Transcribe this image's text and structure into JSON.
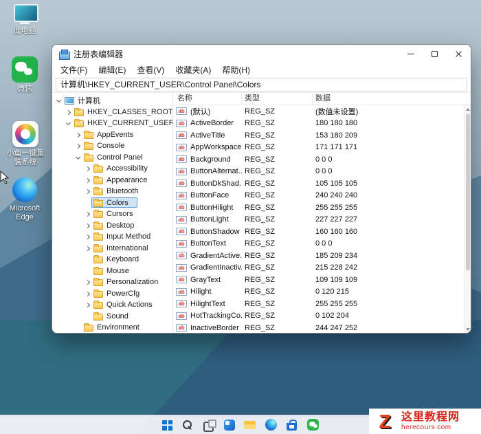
{
  "desktop": {
    "icons": [
      {
        "id": "this-pc",
        "label": "此电脑"
      },
      {
        "id": "wechat",
        "label": "微信"
      },
      {
        "id": "xiaoyu-reinstall",
        "label": "小鱼一键重装系统"
      },
      {
        "id": "microsoft-edge",
        "label": "Microsoft Edge"
      }
    ]
  },
  "window": {
    "title": "注册表编辑器",
    "menus": [
      {
        "id": "file",
        "label": "文件(F)"
      },
      {
        "id": "edit",
        "label": "编辑(E)"
      },
      {
        "id": "view",
        "label": "查看(V)"
      },
      {
        "id": "favorites",
        "label": "收藏夹(A)"
      },
      {
        "id": "help",
        "label": "帮助(H)"
      }
    ],
    "address": "计算机\\HKEY_CURRENT_USER\\Control Panel\\Colors",
    "tree": [
      {
        "id": "computer",
        "label": "计算机",
        "depth": 0,
        "icon": "computer",
        "chevron": "open",
        "selected": false
      },
      {
        "id": "hkey-classes-root",
        "label": "HKEY_CLASSES_ROOT",
        "depth": 1,
        "icon": "folder",
        "chevron": "closed",
        "selected": false
      },
      {
        "id": "hkey-current-user",
        "label": "HKEY_CURRENT_USER",
        "depth": 1,
        "icon": "folder",
        "chevron": "open",
        "selected": false
      },
      {
        "id": "appevents",
        "label": "AppEvents",
        "depth": 2,
        "icon": "folder",
        "chevron": "closed",
        "selected": false
      },
      {
        "id": "console",
        "label": "Console",
        "depth": 2,
        "icon": "folder",
        "chevron": "closed",
        "selected": false
      },
      {
        "id": "control-panel",
        "label": "Control Panel",
        "depth": 2,
        "icon": "folder",
        "chevron": "open",
        "selected": false
      },
      {
        "id": "accessibility",
        "label": "Accessibility",
        "depth": 3,
        "icon": "folder",
        "chevron": "closed",
        "selected": false
      },
      {
        "id": "appearance",
        "label": "Appearance",
        "depth": 3,
        "icon": "folder",
        "chevron": "closed",
        "selected": false
      },
      {
        "id": "bluetooth",
        "label": "Bluetooth",
        "depth": 3,
        "icon": "folder",
        "chevron": "closed",
        "selected": false
      },
      {
        "id": "colors",
        "label": "Colors",
        "depth": 3,
        "icon": "folder",
        "chevron": "none",
        "selected": true
      },
      {
        "id": "cursors",
        "label": "Cursors",
        "depth": 3,
        "icon": "folder",
        "chevron": "closed",
        "selected": false
      },
      {
        "id": "desktop",
        "label": "Desktop",
        "depth": 3,
        "icon": "folder",
        "chevron": "closed",
        "selected": false
      },
      {
        "id": "input-method",
        "label": "Input Method",
        "depth": 3,
        "icon": "folder",
        "chevron": "closed",
        "selected": false
      },
      {
        "id": "international",
        "label": "International",
        "depth": 3,
        "icon": "folder",
        "chevron": "closed",
        "selected": false
      },
      {
        "id": "keyboard",
        "label": "Keyboard",
        "depth": 3,
        "icon": "folder",
        "chevron": "none",
        "selected": false
      },
      {
        "id": "mouse",
        "label": "Mouse",
        "depth": 3,
        "icon": "folder",
        "chevron": "none",
        "selected": false
      },
      {
        "id": "personalization",
        "label": "Personalization",
        "depth": 3,
        "icon": "folder",
        "chevron": "closed",
        "selected": false
      },
      {
        "id": "powercfg",
        "label": "PowerCfg",
        "depth": 3,
        "icon": "folder",
        "chevron": "closed",
        "selected": false
      },
      {
        "id": "quick-actions",
        "label": "Quick Actions",
        "depth": 3,
        "icon": "folder",
        "chevron": "closed",
        "selected": false
      },
      {
        "id": "sound",
        "label": "Sound",
        "depth": 3,
        "icon": "folder",
        "chevron": "none",
        "selected": false
      },
      {
        "id": "environment",
        "label": "Environment",
        "depth": 2,
        "icon": "folder",
        "chevron": "none",
        "selected": false
      }
    ],
    "list": {
      "columns": [
        "名称",
        "类型",
        "数据"
      ],
      "value_icon_label": "ab",
      "rows": [
        {
          "name": "(默认)",
          "type": "REG_SZ",
          "data": "(数值未设置)"
        },
        {
          "name": "ActiveBorder",
          "type": "REG_SZ",
          "data": "180 180 180"
        },
        {
          "name": "ActiveTitle",
          "type": "REG_SZ",
          "data": "153 180 209"
        },
        {
          "name": "AppWorkspace",
          "type": "REG_SZ",
          "data": "171 171 171"
        },
        {
          "name": "Background",
          "type": "REG_SZ",
          "data": "0 0 0"
        },
        {
          "name": "ButtonAlternat...",
          "type": "REG_SZ",
          "data": "0 0 0"
        },
        {
          "name": "ButtonDkShad...",
          "type": "REG_SZ",
          "data": "105 105 105"
        },
        {
          "name": "ButtonFace",
          "type": "REG_SZ",
          "data": "240 240 240"
        },
        {
          "name": "ButtonHilight",
          "type": "REG_SZ",
          "data": "255 255 255"
        },
        {
          "name": "ButtonLight",
          "type": "REG_SZ",
          "data": "227 227 227"
        },
        {
          "name": "ButtonShadow",
          "type": "REG_SZ",
          "data": "160 160 160"
        },
        {
          "name": "ButtonText",
          "type": "REG_SZ",
          "data": "0 0 0"
        },
        {
          "name": "GradientActive...",
          "type": "REG_SZ",
          "data": "185 209 234"
        },
        {
          "name": "GradientInactiv...",
          "type": "REG_SZ",
          "data": "215 228 242"
        },
        {
          "name": "GrayText",
          "type": "REG_SZ",
          "data": "109 109 109"
        },
        {
          "name": "Hilight",
          "type": "REG_SZ",
          "data": "0 120 215"
        },
        {
          "name": "HilightText",
          "type": "REG_SZ",
          "data": "255 255 255"
        },
        {
          "name": "HotTrackingCo...",
          "type": "REG_SZ",
          "data": "0 102 204"
        },
        {
          "name": "InactiveBorder",
          "type": "REG_SZ",
          "data": "244 247 252"
        }
      ]
    }
  },
  "taskbar": {
    "icons": [
      {
        "id": "start"
      },
      {
        "id": "search"
      },
      {
        "id": "task-view"
      },
      {
        "id": "widgets"
      },
      {
        "id": "file-explorer"
      },
      {
        "id": "edge"
      },
      {
        "id": "store"
      },
      {
        "id": "wechat"
      }
    ]
  },
  "watermark": {
    "logo_letter": "Z",
    "title": "这里教程网",
    "domain": "herecours.com"
  },
  "colors": {
    "selection_fill": "#cfe4f7",
    "selection_border": "#5b9bd5",
    "value_icon_text": "#cf3b3b",
    "watermark_red": "#d9251c",
    "taskbar_bg": "#f0f3f7"
  }
}
